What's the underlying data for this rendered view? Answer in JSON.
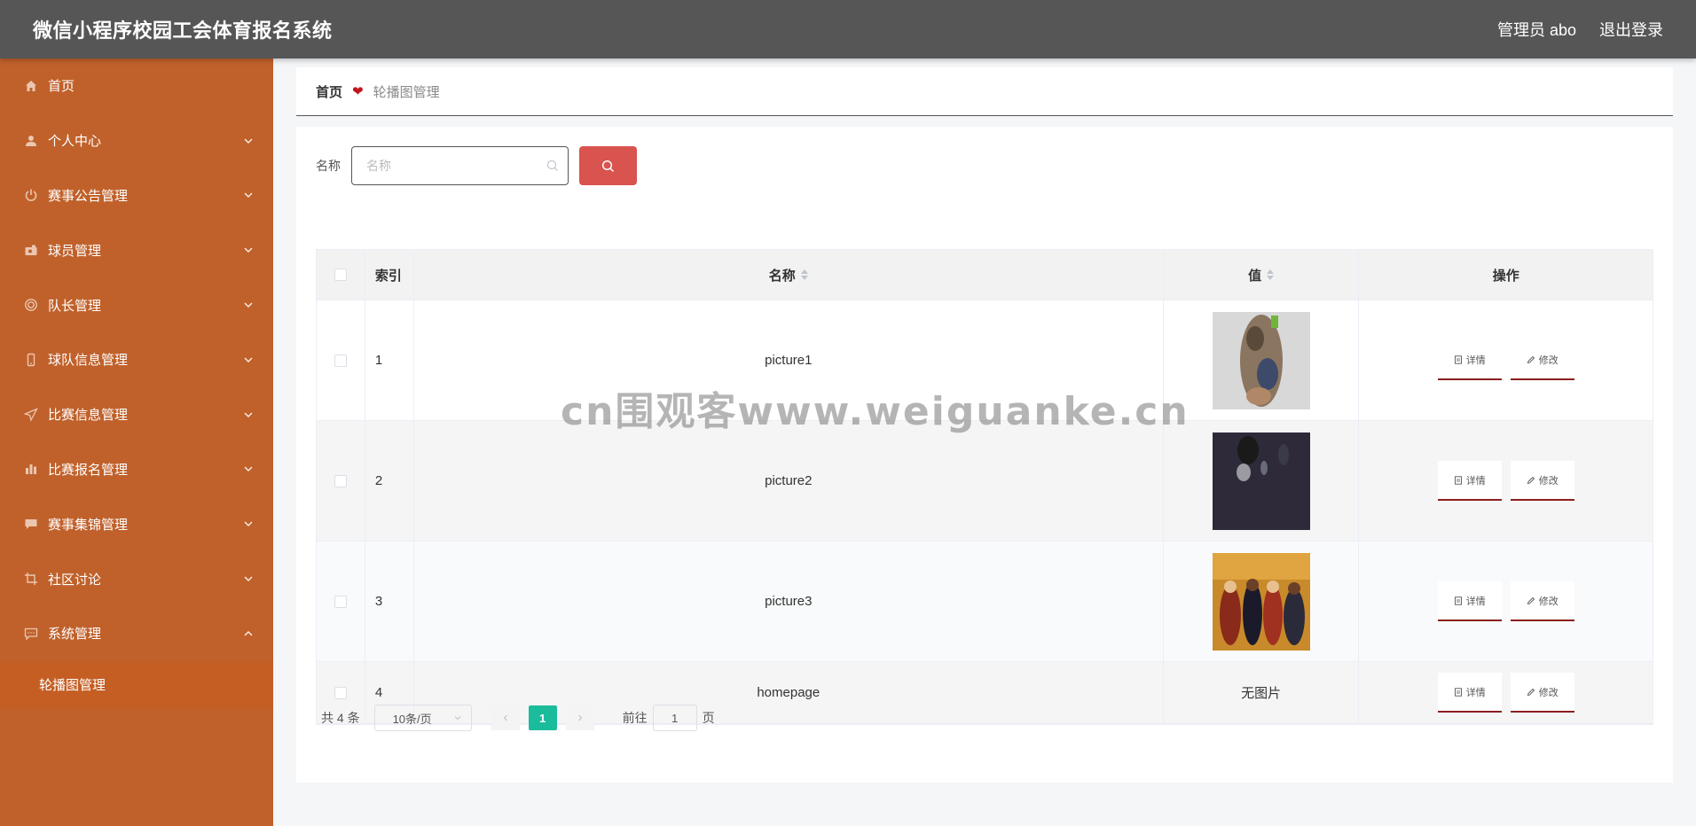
{
  "header": {
    "title": "微信小程序校园工会体育报名系统",
    "admin_label": "管理员 abo",
    "logout_label": "退出登录"
  },
  "sidebar": {
    "items": [
      {
        "label": "首页",
        "icon": "home-icon"
      },
      {
        "label": "个人中心",
        "icon": "user-icon"
      },
      {
        "label": "赛事公告管理",
        "icon": "power-icon"
      },
      {
        "label": "球员管理",
        "icon": "camera-icon"
      },
      {
        "label": "队长管理",
        "icon": "target-icon"
      },
      {
        "label": "球队信息管理",
        "icon": "mobile-icon"
      },
      {
        "label": "比赛信息管理",
        "icon": "send-icon"
      },
      {
        "label": "比赛报名管理",
        "icon": "bar-chart-icon"
      },
      {
        "label": "赛事集锦管理",
        "icon": "chat-icon"
      },
      {
        "label": "社区讨论",
        "icon": "crop-icon"
      },
      {
        "label": "系统管理",
        "icon": "message-icon"
      }
    ],
    "submenu_label": "轮播图管理"
  },
  "breadcrumb": {
    "home": "首页",
    "current": "轮播图管理"
  },
  "search": {
    "label": "名称",
    "placeholder": "名称"
  },
  "table": {
    "headers": {
      "index": "索引",
      "name": "名称",
      "value": "值",
      "operation": "操作"
    },
    "rows": [
      {
        "index": "1",
        "name": "picture1",
        "value": ""
      },
      {
        "index": "2",
        "name": "picture2",
        "value": ""
      },
      {
        "index": "3",
        "name": "picture3",
        "value": ""
      },
      {
        "index": "4",
        "name": "homepage",
        "value": "无图片"
      }
    ],
    "detail_label": "详情",
    "edit_label": "修改"
  },
  "pagination": {
    "total": "共 4 条",
    "page_size": "10条/页",
    "current_page": "1",
    "goto_prefix": "前往",
    "goto_value": "1",
    "goto_suffix": "页"
  },
  "watermark": "cn围观客www.weiguanke.cn",
  "colors": {
    "header_bg": "#565656",
    "sidebar_bg": "#c0612b",
    "search_button": "#d9534f",
    "active_page": "#1abc9c",
    "accent_heart": "#c0151a"
  }
}
